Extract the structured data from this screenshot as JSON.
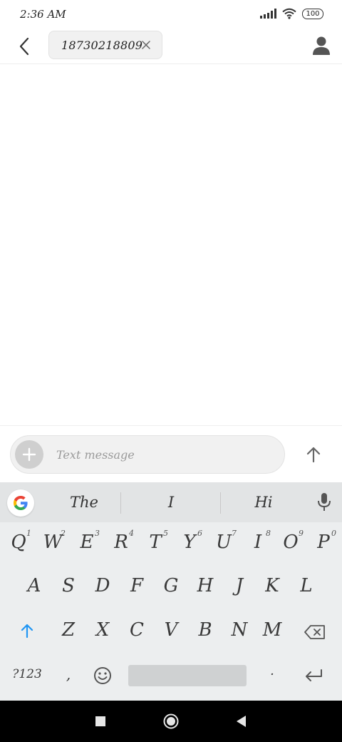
{
  "status_bar": {
    "time": "2:36 AM",
    "battery": "100",
    "icons": [
      "signal-icon",
      "wifi-icon",
      "battery-icon"
    ]
  },
  "header": {
    "back_icon": "chevron-left-icon",
    "recipient": "18730218809",
    "remove_icon": "close-icon",
    "contact_icon": "person-icon"
  },
  "compose": {
    "placeholder": "Text message",
    "value": "",
    "attach_icon": "plus-icon",
    "send_icon": "arrow-up-icon"
  },
  "keyboard": {
    "suggestions": [
      "The",
      "I",
      "Hi"
    ],
    "row1": [
      {
        "key": "Q",
        "alt": "1"
      },
      {
        "key": "W",
        "alt": "2"
      },
      {
        "key": "E",
        "alt": "3"
      },
      {
        "key": "R",
        "alt": "4"
      },
      {
        "key": "T",
        "alt": "5"
      },
      {
        "key": "Y",
        "alt": "6"
      },
      {
        "key": "U",
        "alt": "7"
      },
      {
        "key": "I",
        "alt": "8"
      },
      {
        "key": "O",
        "alt": "9"
      },
      {
        "key": "P",
        "alt": "0"
      }
    ],
    "row2": [
      "A",
      "S",
      "D",
      "F",
      "G",
      "H",
      "J",
      "K",
      "L"
    ],
    "row3": [
      "Z",
      "X",
      "C",
      "V",
      "B",
      "N",
      "M"
    ],
    "symbols_label": "?123",
    "comma": ",",
    "period": "·",
    "accent_color": "#2196f3"
  },
  "nav_bar": {
    "icons": [
      "recents-icon",
      "home-icon",
      "back-triangle-icon"
    ]
  }
}
